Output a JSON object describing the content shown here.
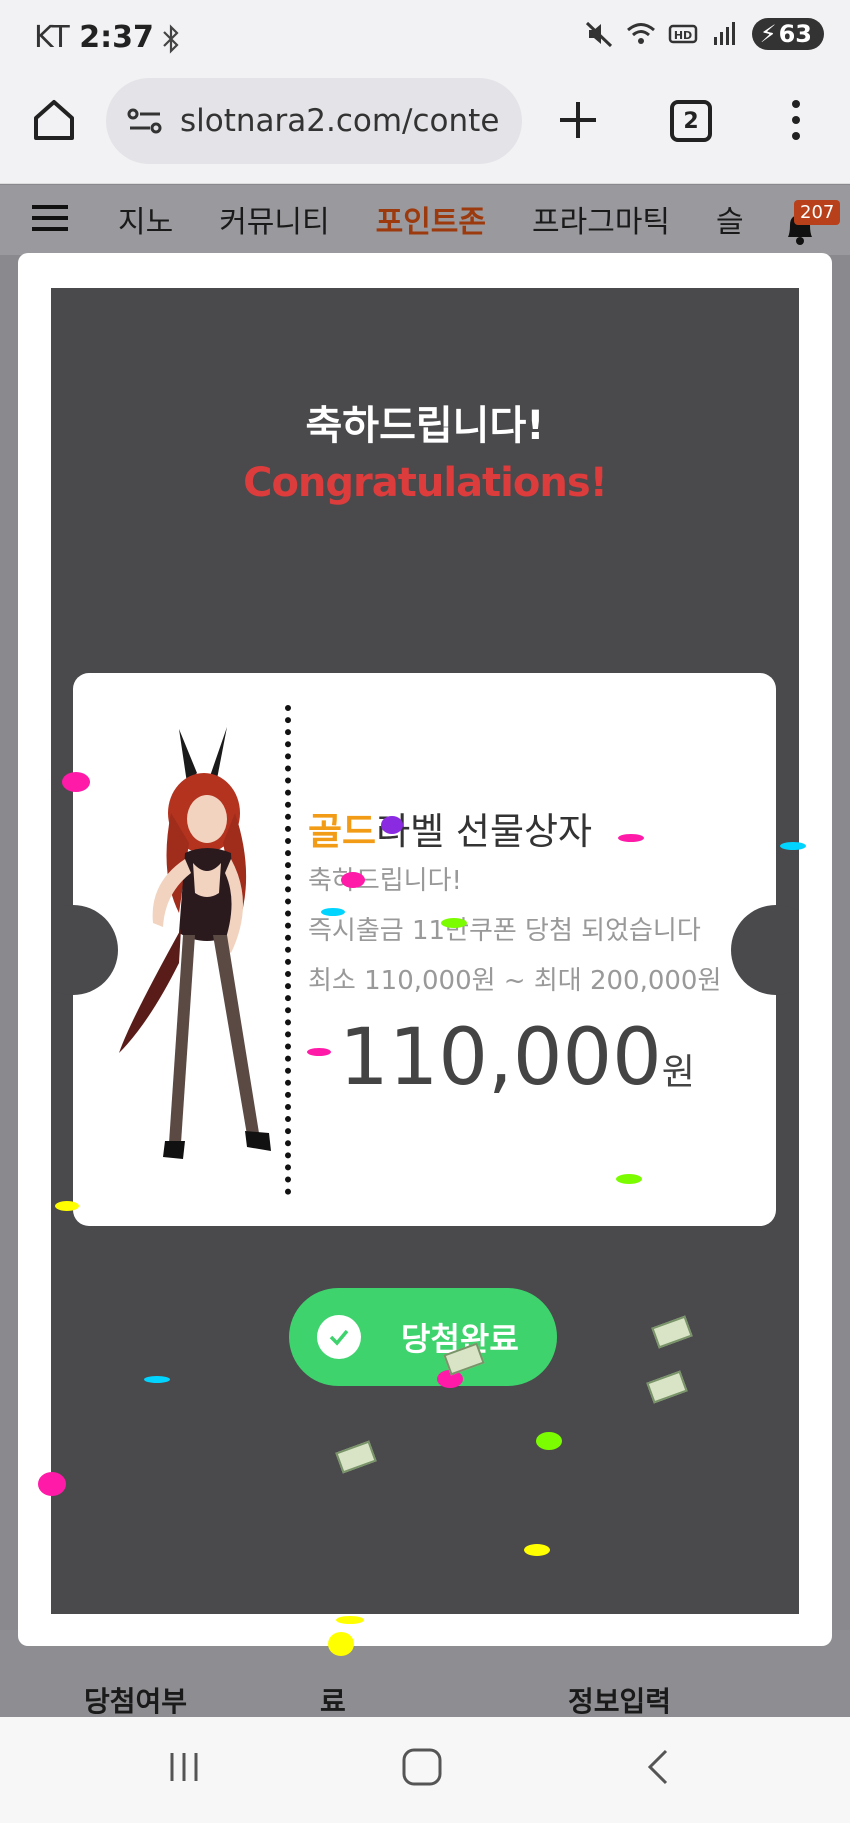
{
  "status_bar": {
    "carrier": "KT",
    "time": "2:37",
    "battery": "63"
  },
  "browser": {
    "url": "slotnara2.com/conte",
    "tab_count": "2"
  },
  "site_nav": {
    "items": [
      "지노",
      "커뮤니티",
      "포인트존",
      "프라그마틱",
      "슬"
    ],
    "active": "포인트존",
    "notification_count": "207"
  },
  "modal": {
    "title_ko": "축하드립니다!",
    "title_en": "Congratulations!",
    "ticket": {
      "label_highlight": "골드",
      "label_rest": "라벨 선물상자",
      "line1": "축하드립니다!",
      "line2": "즉시출금 11만쿠폰 당첨 되었습니다",
      "line3": "최소 110,000원 ~ 최대 200,000원",
      "amount": "110,000",
      "unit": "원"
    },
    "button_label": "당첨완료"
  },
  "background_table": {
    "col1": "당첨여부",
    "col2": "료",
    "col3": "정보입력"
  },
  "colors": {
    "accent_gold": "#f29b16",
    "accent_red": "#dc3c3c",
    "button_green": "#3ed36d",
    "nav_active": "#9c3a0e"
  }
}
